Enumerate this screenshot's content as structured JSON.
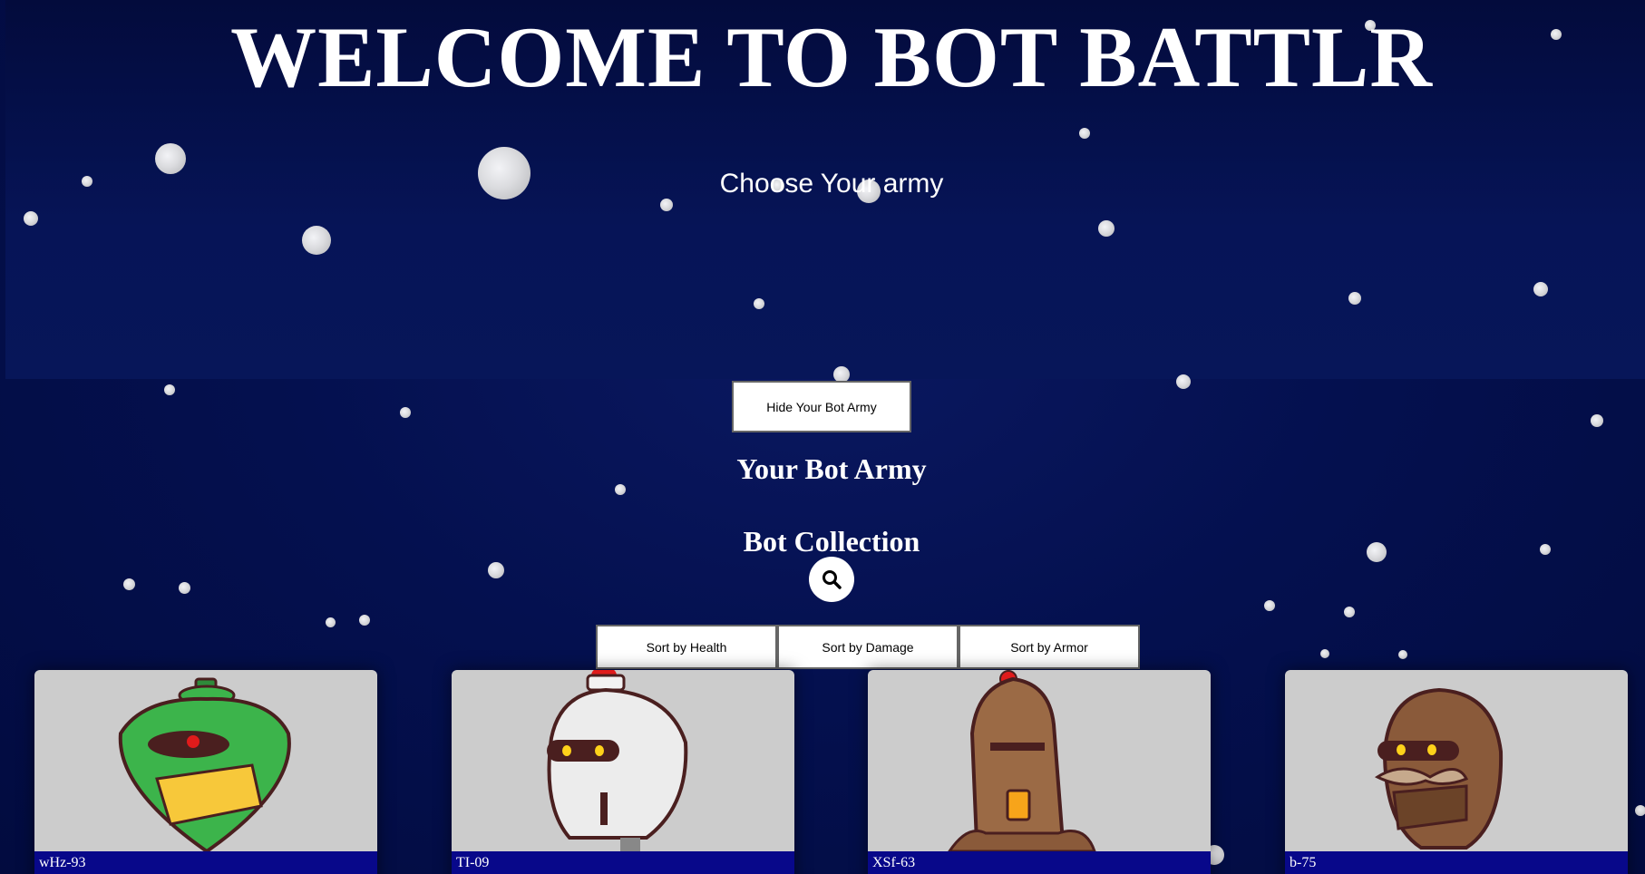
{
  "header": {
    "title": "WELCOME TO BOT BATTLR",
    "subtitle": "Choose Your army"
  },
  "army": {
    "toggle_label": "Hide Your Bot Army",
    "heading": "Your Bot Army"
  },
  "collection": {
    "heading": "Bot Collection",
    "search_icon": "search-icon",
    "sort_buttons": [
      "Sort by Health",
      "Sort by Damage",
      "Sort by Armor"
    ]
  },
  "bots": [
    {
      "name": "wHz-93",
      "color": "#3cb44b"
    },
    {
      "name": "TI-09",
      "color": "#e8e8e8"
    },
    {
      "name": "XSf-63",
      "color": "#9b6a45"
    },
    {
      "name": "b-75",
      "color": "#8a5a3a"
    }
  ],
  "colors": {
    "background": "#04104f",
    "card_label_bg": "#08088a",
    "card_bg": "#cccccc"
  }
}
